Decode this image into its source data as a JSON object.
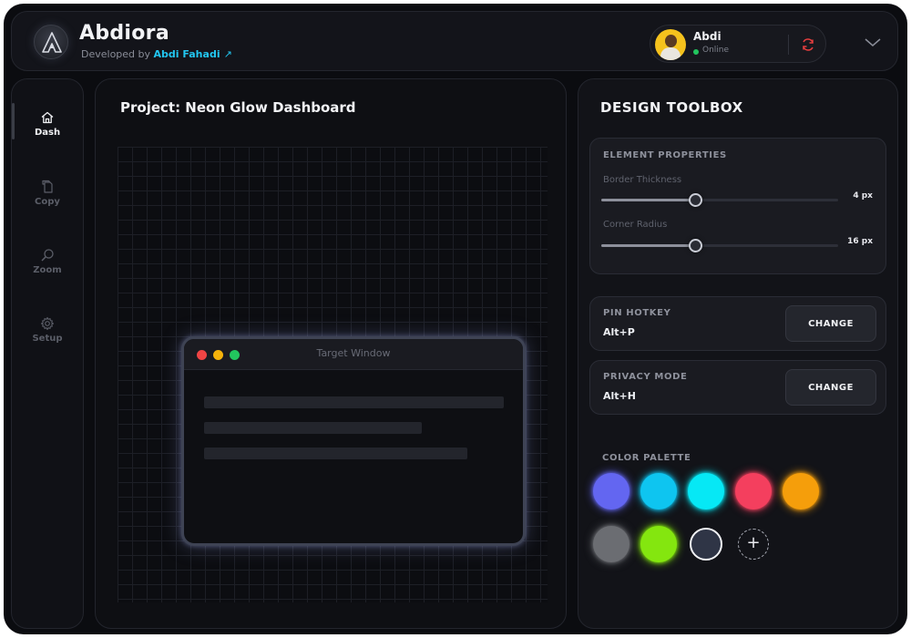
{
  "app": {
    "title": "Abdiora",
    "developed_by_prefix": "Developed by ",
    "developer_name": "Abdi Fahadi",
    "developer_arrow": "↗"
  },
  "user": {
    "name": "Abdi",
    "status": "Online",
    "status_color": "#22c55e",
    "sync_icon": "refresh-icon",
    "menu_icon": "chevron-down-icon"
  },
  "sidebar": {
    "items": [
      {
        "label": "Dash",
        "icon": "home-icon",
        "active": true
      },
      {
        "label": "Copy",
        "icon": "copy-icon",
        "active": false
      },
      {
        "label": "Zoom",
        "icon": "search-icon",
        "active": false
      },
      {
        "label": "Setup",
        "icon": "gear-icon",
        "active": false
      }
    ]
  },
  "canvas": {
    "project_title": "Project: Neon Glow Dashboard",
    "target_window": {
      "title": "Target Window",
      "dot_colors": [
        "#ef4444",
        "#f5b30b",
        "#22c55e"
      ]
    }
  },
  "toolbox": {
    "title": "DESIGN TOOLBOX",
    "element_properties": {
      "heading": "ELEMENT PROPERTIES",
      "border_thickness": {
        "label": "Border Thickness",
        "value": "4 px",
        "fraction": 0.4
      },
      "corner_radius": {
        "label": "Corner Radius",
        "value": "16 px",
        "fraction": 0.4
      }
    },
    "pin_hotkey": {
      "heading": "PIN HOTKEY",
      "value": "Alt+P",
      "button": "CHANGE"
    },
    "privacy_mode": {
      "heading": "PRIVACY MODE",
      "value": "Alt+H",
      "button": "CHANGE"
    },
    "palette": {
      "heading": "COLOR PALETTE",
      "colors": [
        "#6366f1",
        "#0ec5f0",
        "#06e8f5",
        "#f43f5e",
        "#f59e0b",
        "#6b6d72",
        "#84e60f",
        "#2f3546"
      ],
      "selected_index": 7,
      "add_label": "+"
    }
  }
}
